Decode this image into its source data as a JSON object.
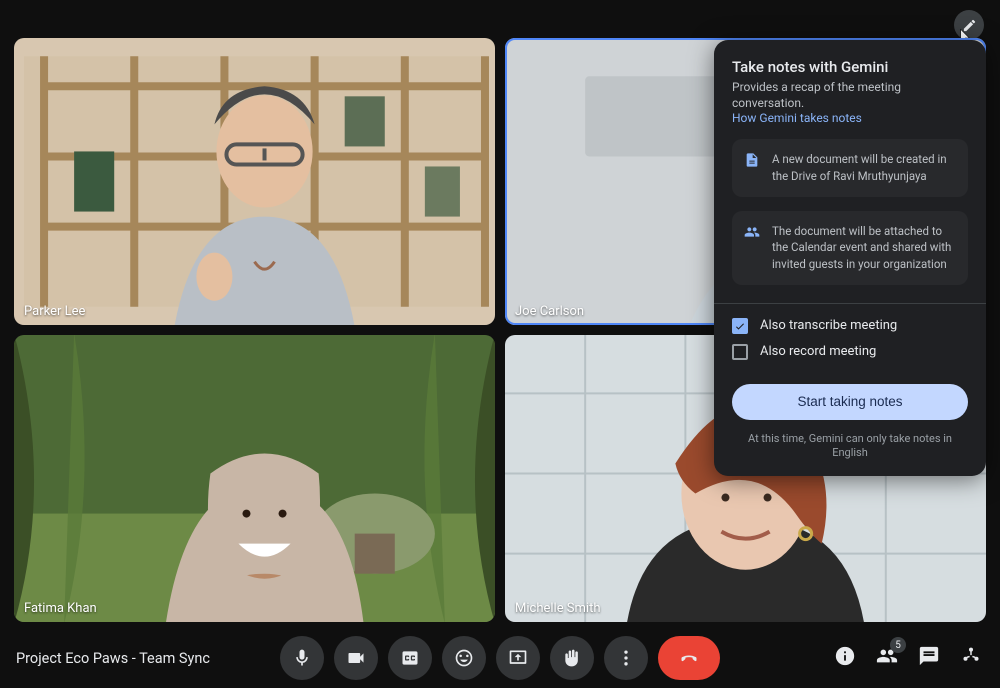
{
  "meeting": {
    "title": "Project Eco Paws - Team Sync"
  },
  "participants": [
    {
      "name": "Parker Lee",
      "active": false
    },
    {
      "name": "Joe Carlson",
      "active": true
    },
    {
      "name": "Fatima Khan",
      "active": false
    },
    {
      "name": "Michelle Smith",
      "active": false
    }
  ],
  "people_count": "5",
  "panel": {
    "title": "Take notes with Gemini",
    "subtitle": "Provides a recap of the meeting conversation.",
    "link": "How Gemini takes notes",
    "info1": "A new document will be created in the Drive of Ravi Mruthyunjaya",
    "info2": "The document will be attached to the Calendar event and shared with invited guests in your organization",
    "opt_transcribe": "Also transcribe meeting",
    "opt_record": "Also record meeting",
    "button": "Start taking notes",
    "footer": "At this time, Gemini can only take notes in English"
  }
}
